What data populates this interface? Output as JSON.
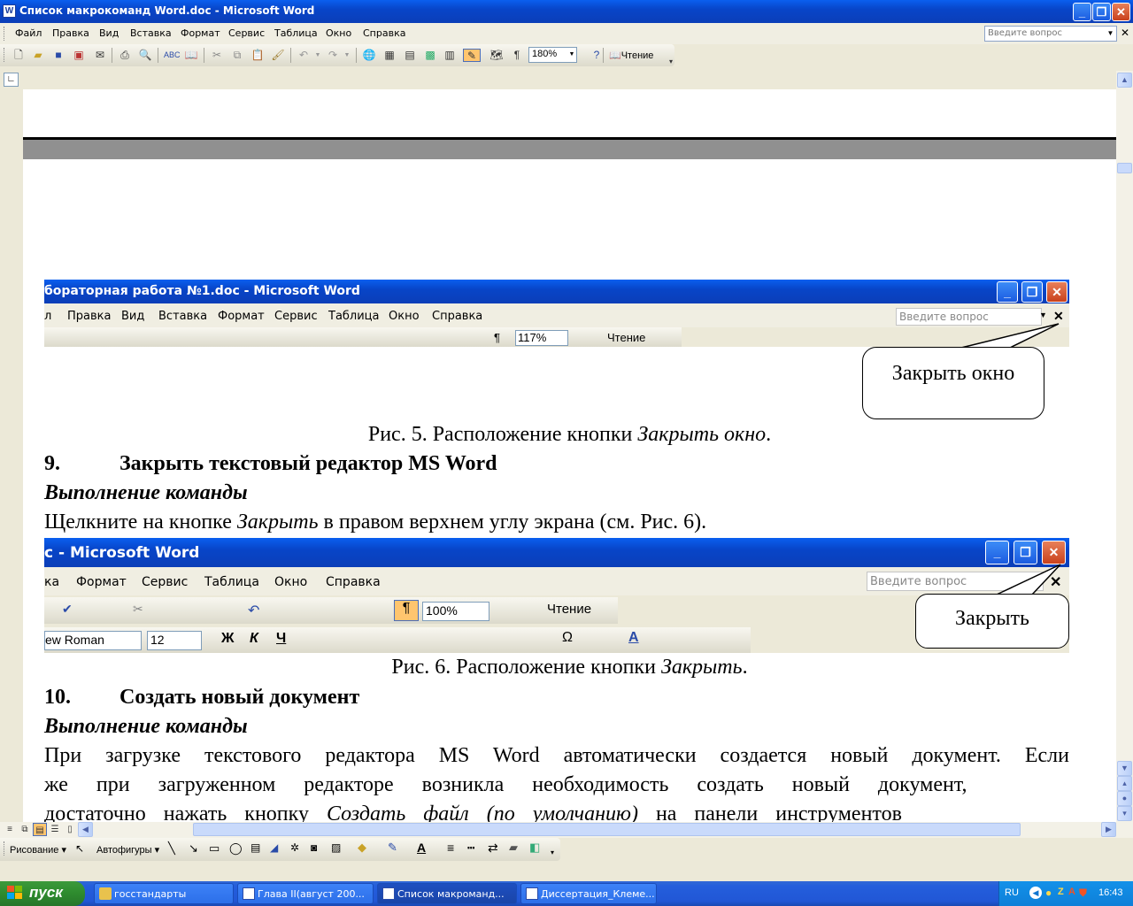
{
  "window": {
    "title": "Список макрокоманд Word.doc - Microsoft Word",
    "app_icon": "W"
  },
  "menu": {
    "items": [
      "Файл",
      "Правка",
      "Вид",
      "Вставка",
      "Формат",
      "Сервис",
      "Таблица",
      "Окно",
      "Справка"
    ],
    "ask_placeholder": "Введите вопрос"
  },
  "toolbar": {
    "zoom": "180%",
    "reading_label": "Чтение"
  },
  "document": {
    "fig5": {
      "title": "бораторная работа №1.doc - Microsoft Word",
      "menu": [
        "л",
        "Правка",
        "Вид",
        "Вставка",
        "Формат",
        "Сервис",
        "Таблица",
        "Окно",
        "Справка"
      ],
      "ask": "Введите вопрос",
      "zoom": "117%",
      "reading": "Чтение",
      "callout": "Закрыть окно",
      "caption_prefix": "Рис. 5. Расположение кнопки ",
      "caption_italic": "Закрыть окно",
      "caption_suffix": "."
    },
    "section9": {
      "number": "9.",
      "title": "Закрыть текстовый редактор MS Word",
      "subtitle": "Выполнение команды",
      "text_prefix": "Щелкните на кнопке ",
      "text_italic": "Закрыть",
      "text_suffix": " в правом верхнем углу экрана (см. Рис. 6)."
    },
    "fig6": {
      "title": "с - Microsoft Word",
      "menu": [
        "ка",
        "Формат",
        "Сервис",
        "Таблица",
        "Окно",
        "Справка"
      ],
      "ask": "Введите вопрос",
      "zoom": "100%",
      "reading": "Чтение",
      "font": "ew Roman",
      "size": "12",
      "callout": "Закрыть",
      "caption_prefix": "Рис. 6. Расположение кнопки ",
      "caption_italic": "Закрыть",
      "caption_suffix": "."
    },
    "section10": {
      "number": "10.",
      "title": "Создать новый документ",
      "subtitle": "Выполнение команды",
      "line1": "При загрузке текстового редактора MS Word автоматически создается новый документ. Если",
      "line2": "же при загруженном редакторе возникла необходимость создать новый документ,",
      "line3_prefix": "достаточно нажать кнопку ",
      "line3_italic": "Создать файл (по умолчанию)",
      "line3_suffix": " на панели инструментов"
    }
  },
  "drawing": {
    "draw_label": "Рисование",
    "autoshapes_label": "Автофигуры"
  },
  "taskbar": {
    "start": "пуск",
    "tasks": [
      "госстандарты",
      "Глава II(август 200...",
      "Список макроманд...",
      "Диссертация_Клеме..."
    ],
    "lang": "RU",
    "clock": "16:43"
  }
}
